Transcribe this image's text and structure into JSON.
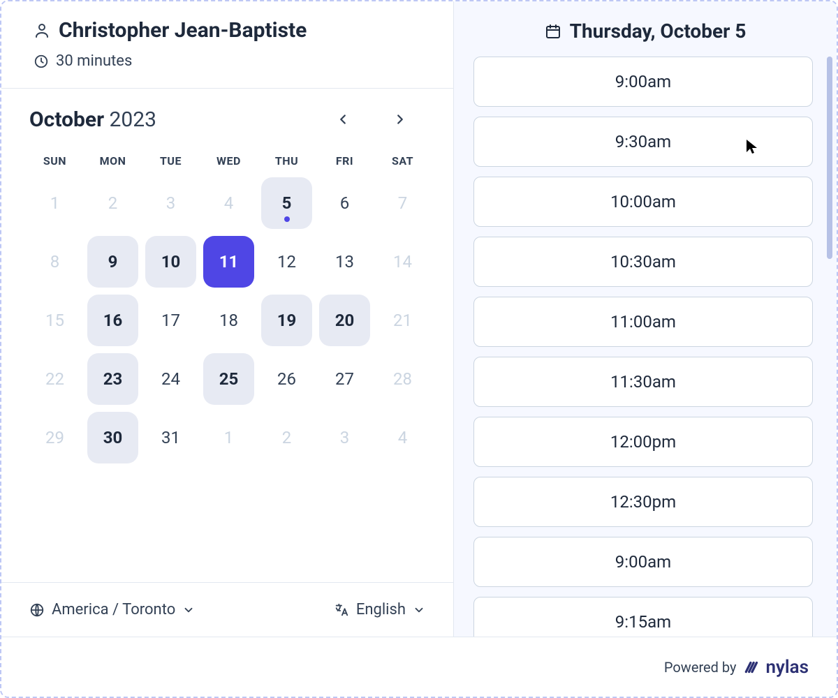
{
  "host": {
    "name": "Christopher Jean-Baptiste",
    "duration": "30 minutes"
  },
  "calendar": {
    "month_name": "October",
    "year": "2023",
    "dow": [
      "SUN",
      "MON",
      "TUE",
      "WED",
      "THU",
      "FRI",
      "SAT"
    ],
    "weeks": [
      [
        {
          "n": "1",
          "state": "disabled"
        },
        {
          "n": "2",
          "state": "disabled"
        },
        {
          "n": "3",
          "state": "disabled"
        },
        {
          "n": "4",
          "state": "disabled"
        },
        {
          "n": "5",
          "state": "today"
        },
        {
          "n": "6",
          "state": "normal"
        },
        {
          "n": "7",
          "state": "disabled"
        }
      ],
      [
        {
          "n": "8",
          "state": "disabled"
        },
        {
          "n": "9",
          "state": "avail"
        },
        {
          "n": "10",
          "state": "avail"
        },
        {
          "n": "11",
          "state": "selected"
        },
        {
          "n": "12",
          "state": "normal"
        },
        {
          "n": "13",
          "state": "normal"
        },
        {
          "n": "14",
          "state": "disabled"
        }
      ],
      [
        {
          "n": "15",
          "state": "disabled"
        },
        {
          "n": "16",
          "state": "avail"
        },
        {
          "n": "17",
          "state": "normal"
        },
        {
          "n": "18",
          "state": "normal"
        },
        {
          "n": "19",
          "state": "avail"
        },
        {
          "n": "20",
          "state": "avail"
        },
        {
          "n": "21",
          "state": "disabled"
        }
      ],
      [
        {
          "n": "22",
          "state": "disabled"
        },
        {
          "n": "23",
          "state": "avail"
        },
        {
          "n": "24",
          "state": "normal"
        },
        {
          "n": "25",
          "state": "avail"
        },
        {
          "n": "26",
          "state": "normal"
        },
        {
          "n": "27",
          "state": "normal"
        },
        {
          "n": "28",
          "state": "disabled"
        }
      ],
      [
        {
          "n": "29",
          "state": "disabled"
        },
        {
          "n": "30",
          "state": "avail"
        },
        {
          "n": "31",
          "state": "normal"
        },
        {
          "n": "1",
          "state": "other-month"
        },
        {
          "n": "2",
          "state": "other-month"
        },
        {
          "n": "3",
          "state": "other-month"
        },
        {
          "n": "4",
          "state": "other-month"
        }
      ]
    ]
  },
  "footer": {
    "timezone": "America / Toronto",
    "language": "English"
  },
  "right": {
    "selected_day_label": "Thursday, October 5",
    "slots": [
      "9:00am",
      "9:30am",
      "10:00am",
      "10:30am",
      "11:00am",
      "11:30am",
      "12:00pm",
      "12:30pm",
      "9:00am",
      "9:15am"
    ]
  },
  "brand": {
    "powered": "Powered by",
    "name": "nylas"
  }
}
